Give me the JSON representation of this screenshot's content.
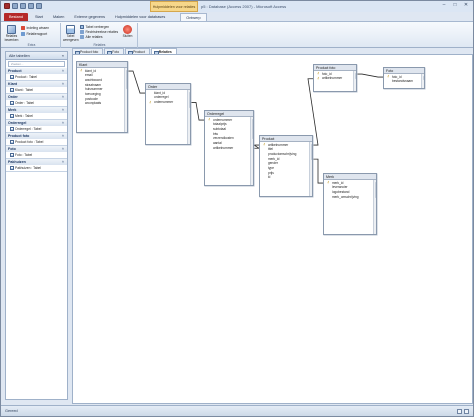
{
  "window": {
    "title": "p5 : Database (Access 2007) - Microsoft Access",
    "context_tab": "Hulpmiddelen voor relaties",
    "controls": {
      "minimize": "–",
      "maximize": "□",
      "close": "✕"
    }
  },
  "qat": {
    "icons": [
      "access-icon",
      "save-icon",
      "undo-icon",
      "redo-icon",
      "customize-icon"
    ]
  },
  "ribbon_tabs": [
    "Bestand",
    "Start",
    "Maken",
    "Externe gegevens",
    "Hulpmiddelen voor databases",
    "Ontwerp"
  ],
  "ribbon": {
    "groups": {
      "extra": {
        "label": "Extra",
        "edit_relations": "Relaties bewerken",
        "clear_layout": "Indeling wissen",
        "relationship_report": "Relatierapport"
      },
      "relaties": {
        "label": "Relaties",
        "show_table": "Tabel weergeven",
        "hide_table": "Tabel verbergen",
        "direct_relations": "Rechtstreekse relaties",
        "all_relations": "Alle relaties",
        "close": "Sluiten"
      }
    }
  },
  "nav": {
    "header": "Alle tabellen",
    "search_placeholder": "Zoeken...",
    "groups": [
      {
        "title": "Product",
        "items": [
          "Product : Tabel"
        ]
      },
      {
        "title": "Klant",
        "items": [
          "Klant : Tabel"
        ]
      },
      {
        "title": "Order",
        "items": [
          "Order : Tabel"
        ]
      },
      {
        "title": "Merk",
        "items": [
          "Merk : Tabel"
        ]
      },
      {
        "title": "Orderregel",
        "items": [
          "Orderregel : Tabel"
        ]
      },
      {
        "title": "Product foto",
        "items": [
          "Product foto : Tabel"
        ]
      },
      {
        "title": "Foto",
        "items": [
          "Foto : Tabel"
        ]
      },
      {
        "title": "Pakhuizen",
        "items": [
          "Pakhuizen : Tabel"
        ]
      }
    ]
  },
  "doc_tabs": [
    "Product foto",
    "Foto",
    "Product",
    "Relaties"
  ],
  "tables": [
    {
      "id": "klant",
      "name": "Klant",
      "fields": [
        {
          "name": "klant_id",
          "key": true
        },
        {
          "name": "email"
        },
        {
          "name": "wachtwoord"
        },
        {
          "name": "straatnaam"
        },
        {
          "name": "huisnummer"
        },
        {
          "name": "toevoeging"
        },
        {
          "name": "postcode"
        },
        {
          "name": "woonplaats"
        }
      ]
    },
    {
      "id": "order",
      "name": "Order",
      "fields": [
        {
          "name": "klant_id"
        },
        {
          "name": "orderregel"
        },
        {
          "name": "ordernummer",
          "key": true
        }
      ]
    },
    {
      "id": "orderregel",
      "name": "Orderregel",
      "fields": [
        {
          "name": "ordernummer",
          "key": true
        },
        {
          "name": "totaalprijs"
        },
        {
          "name": "subtotaal"
        },
        {
          "name": "btw"
        },
        {
          "name": "verzendkosten"
        },
        {
          "name": "aantal"
        },
        {
          "name": "artikelnummer"
        }
      ]
    },
    {
      "id": "product",
      "name": "Product",
      "fields": [
        {
          "name": "artikelnummer",
          "key": true
        },
        {
          "name": "titel"
        },
        {
          "name": "productomschrijving"
        },
        {
          "name": "merk_id"
        },
        {
          "name": "gender"
        },
        {
          "name": "type"
        },
        {
          "name": "prijs"
        },
        {
          "name": "kl"
        }
      ]
    },
    {
      "id": "productfoto",
      "name": "Product foto",
      "fields": [
        {
          "name": "foto_id",
          "key": true
        },
        {
          "name": "artikelnummer",
          "key": true
        }
      ]
    },
    {
      "id": "foto",
      "name": "Foto",
      "fields": [
        {
          "name": "foto_id",
          "key": true
        },
        {
          "name": "bestandsnaam"
        }
      ]
    },
    {
      "id": "merk",
      "name": "Merk",
      "fields": [
        {
          "name": "merk_id",
          "key": true
        },
        {
          "name": "leverancier"
        },
        {
          "name": "logobestand"
        },
        {
          "name": "merk_omschrijving"
        }
      ]
    }
  ],
  "relationships": [
    {
      "from": "klant",
      "from_field": 0,
      "to": "order",
      "to_field": 0
    },
    {
      "from": "order",
      "from_field": 2,
      "to": "orderregel",
      "to_field": 0
    },
    {
      "from": "orderregel",
      "from_field": 6,
      "to": "product",
      "to_field": 0
    },
    {
      "from": "product",
      "from_field": 0,
      "to": "productfoto",
      "to_field": 1
    },
    {
      "from": "productfoto",
      "from_field": 0,
      "to": "foto",
      "to_field": 0
    },
    {
      "from": "product",
      "from_field": 3,
      "to": "merk",
      "to_field": 0
    }
  ],
  "status": {
    "text": "Gereed"
  }
}
